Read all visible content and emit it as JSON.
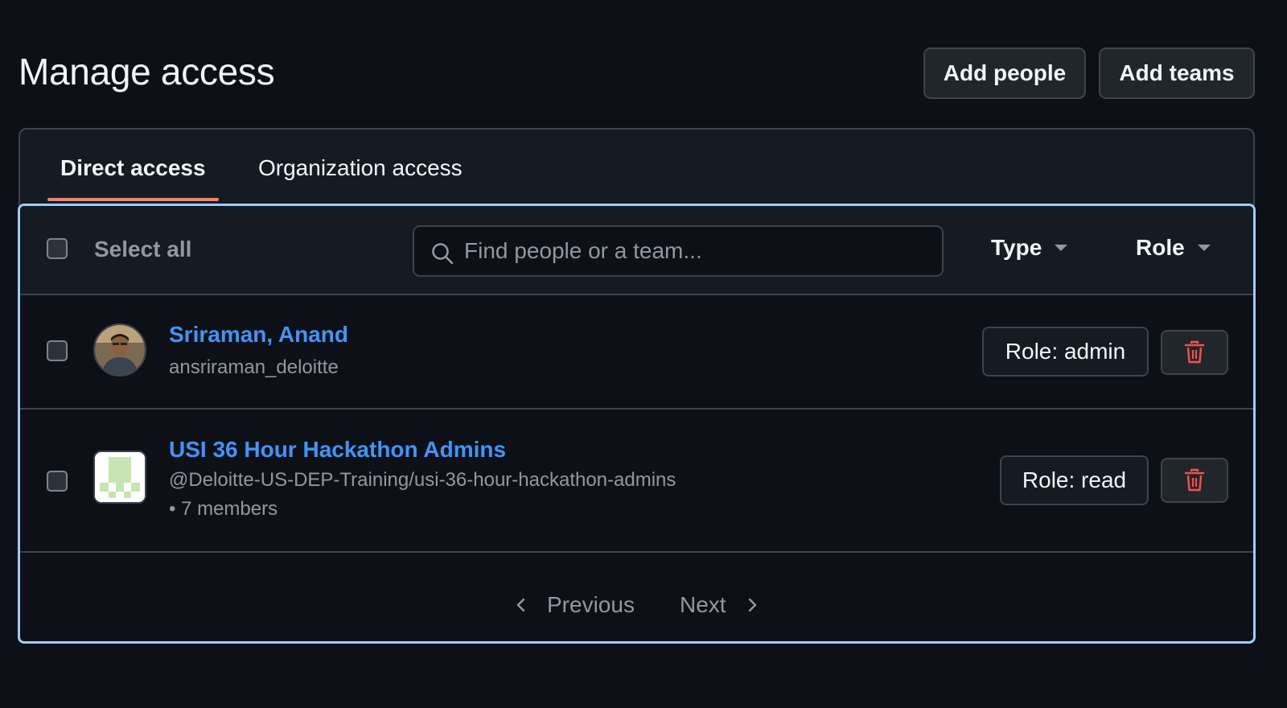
{
  "header": {
    "title": "Manage access",
    "add_people_label": "Add people",
    "add_teams_label": "Add teams"
  },
  "tabs": [
    {
      "label": "Direct access",
      "active": true
    },
    {
      "label": "Organization access",
      "active": false
    }
  ],
  "toolbar": {
    "select_all_label": "Select all",
    "search_placeholder": "Find people or a team...",
    "search_icon": "search-icon",
    "type_filter_label": "Type",
    "role_filter_label": "Role"
  },
  "members": [
    {
      "name": "Sriraman, Anand",
      "subtitle": "ansriraman_deloitte",
      "role_label": "Role: admin",
      "avatar": "user-photo"
    },
    {
      "name": "USI 36 Hour Hackathon Admins",
      "subtitle": "@Deloitte-US-DEP-Training/usi-36-hour-hackathon-admins • 7 members",
      "role_label": "Role: read",
      "avatar": "team-identicon"
    }
  ],
  "pagination": {
    "previous_label": "Previous",
    "next_label": "Next"
  },
  "colors": {
    "background": "#0d1117",
    "link": "#4493f8",
    "active_tab_underline": "#f78166",
    "focus_border": "#9ecbff",
    "danger": "#f85149",
    "identicon": "#c6e5b3"
  }
}
